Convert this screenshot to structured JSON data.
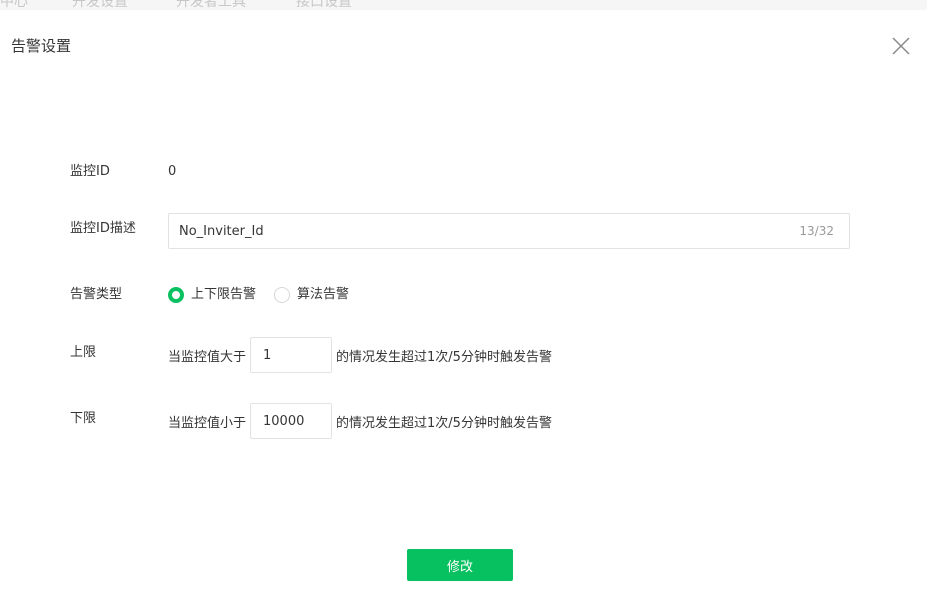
{
  "background_nav": [
    "中心",
    "开发设置",
    "开发者工具",
    "接口设置"
  ],
  "dialog": {
    "title": "告警设置",
    "close_icon": "close-icon"
  },
  "form": {
    "monitor_id": {
      "label": "监控ID",
      "value": "0"
    },
    "monitor_desc": {
      "label": "监控ID描述",
      "value": "No_Inviter_Id",
      "counter": "13/32"
    },
    "alarm_type": {
      "label": "告警类型",
      "options": [
        {
          "label": "上下限告警",
          "checked": true
        },
        {
          "label": "算法告警",
          "checked": false
        }
      ]
    },
    "upper_limit": {
      "label": "上限",
      "prefix": "当监控值大于",
      "value": "1",
      "suffix": "的情况发生超过1次/5分钟时触发告警"
    },
    "lower_limit": {
      "label": "下限",
      "prefix": "当监控值小于",
      "value": "10000",
      "suffix": "的情况发生超过1次/5分钟时触发告警"
    }
  },
  "submit_label": "修改",
  "colors": {
    "accent": "#07c160",
    "text": "#353535",
    "border": "#e2e2e2",
    "muted": "#9a9a9a"
  }
}
